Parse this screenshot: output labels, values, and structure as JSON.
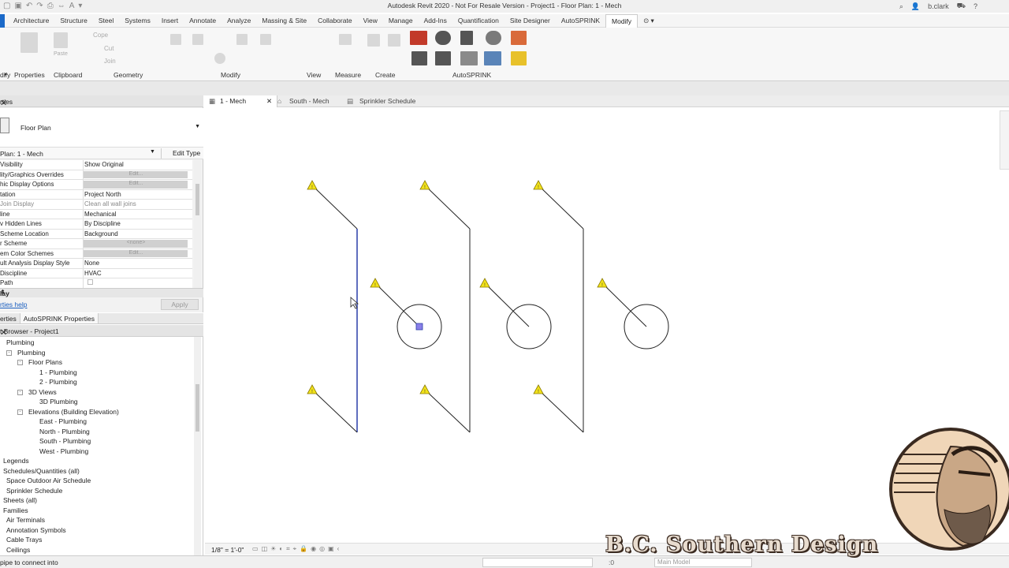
{
  "window": {
    "title": "Autodesk Revit 2020 - Not For Resale Version - Project1 - Floor Plan: 1 - Mech",
    "user": "b.clark"
  },
  "ribbon_tabs": [
    "Architecture",
    "Structure",
    "Steel",
    "Systems",
    "Insert",
    "Annotate",
    "Analyze",
    "Massing & Site",
    "Collaborate",
    "View",
    "Manage",
    "Add-Ins",
    "Quantification",
    "Site Designer",
    "AutoSPRINK",
    "Modify"
  ],
  "ribbon_active_tab": "Modify",
  "ribbon_panels": {
    "modify_short": "dify",
    "properties": "Properties",
    "clipboard": "Clipboard",
    "geometry": "Geometry",
    "modify": "Modify",
    "view": "View",
    "measure": "Measure",
    "create": "Create",
    "autosprink": "AutoSPRINK",
    "copy": "Cope",
    "cut": "Cut",
    "join": "Join",
    "paste": "Paste"
  },
  "properties": {
    "header": "rties",
    "type": "Floor Plan",
    "instance": "Plan: 1 - Mech",
    "edit_type": "Edit Type",
    "rows": [
      {
        "key": "Visibility",
        "value": "Show Original"
      },
      {
        "key": "lity/Graphics Overrides",
        "value": "Edit..."
      },
      {
        "key": "hic Display Options",
        "value": "Edit..."
      },
      {
        "key": "tation",
        "value": "Project North"
      },
      {
        "key": "Join Display",
        "value": "Clean all wall joins"
      },
      {
        "key": "line",
        "value": "Mechanical"
      },
      {
        "key": "v Hidden Lines",
        "value": "By Discipline"
      },
      {
        "key": "Scheme Location",
        "value": "Background"
      },
      {
        "key": "r Scheme",
        "value": "<none>"
      },
      {
        "key": "em Color Schemes",
        "value": "Edit..."
      },
      {
        "key": "ult Analysis Display Style",
        "value": "None"
      },
      {
        "key": "Discipline",
        "value": "HVAC"
      },
      {
        "key": "Path",
        "value": ""
      }
    ],
    "section": "lay",
    "help_link": "rties help",
    "apply": "Apply"
  },
  "panel_tabs": [
    "erties",
    "AutoSPRINK Properties"
  ],
  "browser": {
    "header": "t Browser - Project1",
    "items": [
      {
        "label": "Plumbing",
        "level": 0
      },
      {
        "label": "Plumbing",
        "level": 1,
        "box": "-"
      },
      {
        "label": "Floor Plans",
        "level": 2,
        "box": "-"
      },
      {
        "label": "1 - Plumbing",
        "level": 3
      },
      {
        "label": "2 - Plumbing",
        "level": 3
      },
      {
        "label": "3D Views",
        "level": 2,
        "box": "-"
      },
      {
        "label": "3D Plumbing",
        "level": 3
      },
      {
        "label": "Elevations (Building Elevation)",
        "level": 2,
        "box": "-"
      },
      {
        "label": "East - Plumbing",
        "level": 3
      },
      {
        "label": "North - Plumbing",
        "level": 3
      },
      {
        "label": "South - Plumbing",
        "level": 3
      },
      {
        "label": "West - Plumbing",
        "level": 3
      },
      {
        "label": "Legends",
        "level": -1
      },
      {
        "label": "Schedules/Quantities (all)",
        "level": -1
      },
      {
        "label": "Space Outdoor Air Schedule",
        "level": -2
      },
      {
        "label": "Sprinkler Schedule",
        "level": -2
      },
      {
        "label": "Sheets (all)",
        "level": -1
      },
      {
        "label": "Families",
        "level": -1
      },
      {
        "label": "Air Terminals",
        "level": -2
      },
      {
        "label": "Annotation Symbols",
        "level": -2
      },
      {
        "label": "Cable Trays",
        "level": -2
      },
      {
        "label": "Ceilings",
        "level": -2
      }
    ]
  },
  "view_tabs": [
    {
      "label": "1 - Mech",
      "active": true
    },
    {
      "label": "South - Mech",
      "active": false
    },
    {
      "label": "Sprinkler Schedule",
      "active": false
    }
  ],
  "view_control": {
    "scale": "1/8\" = 1'-0\""
  },
  "status": {
    "message": "pipe to connect into",
    "zero": ":0",
    "model": "Main Model"
  },
  "branding": {
    "text": "B.C. Southern Design"
  },
  "colors": {
    "accent": "#1b6ac9",
    "warning": "#f2e21a",
    "selected_pipe": "#2a3fa8"
  }
}
